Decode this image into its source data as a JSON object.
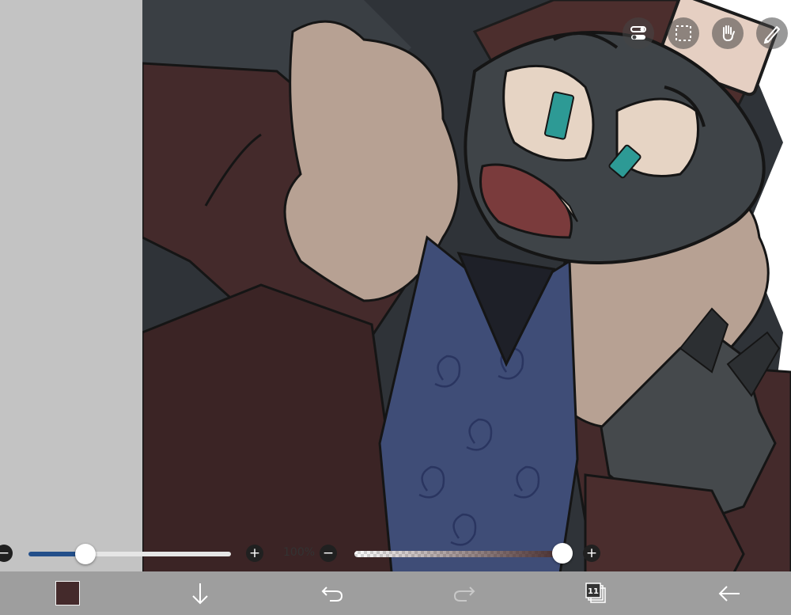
{
  "toolbar": {
    "icons": [
      "toggle-settings-icon",
      "selection-icon",
      "hand-icon",
      "ruler-icon"
    ]
  },
  "brush_size": {
    "value_fraction": 0.28
  },
  "opacity": {
    "label": "100%",
    "value_fraction": 0.99
  },
  "bottom_bar": {
    "current_color": "#442a2b",
    "layers_count": "11"
  },
  "colors": {
    "left_panel": "#c3c3c3",
    "bottom_bar": "#9e9e9e",
    "slider_accent": "#234f8a"
  }
}
